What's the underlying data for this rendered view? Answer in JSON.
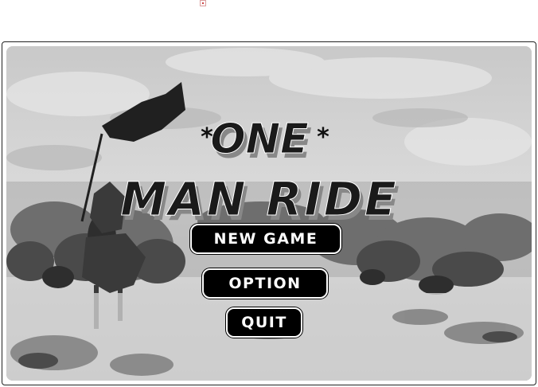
{
  "game": {
    "title_line1": "ONE",
    "title_line2": "MAN RIDE",
    "title_star": "*"
  },
  "menu": {
    "new_game": "NEW GAME",
    "option": "OPTION",
    "quit": "QUIT"
  },
  "colors": {
    "button_bg": "#000000",
    "button_text": "#ffffff",
    "title_fill": "#1a1a1a"
  },
  "icons": {
    "broken_image": "broken-image-icon"
  }
}
